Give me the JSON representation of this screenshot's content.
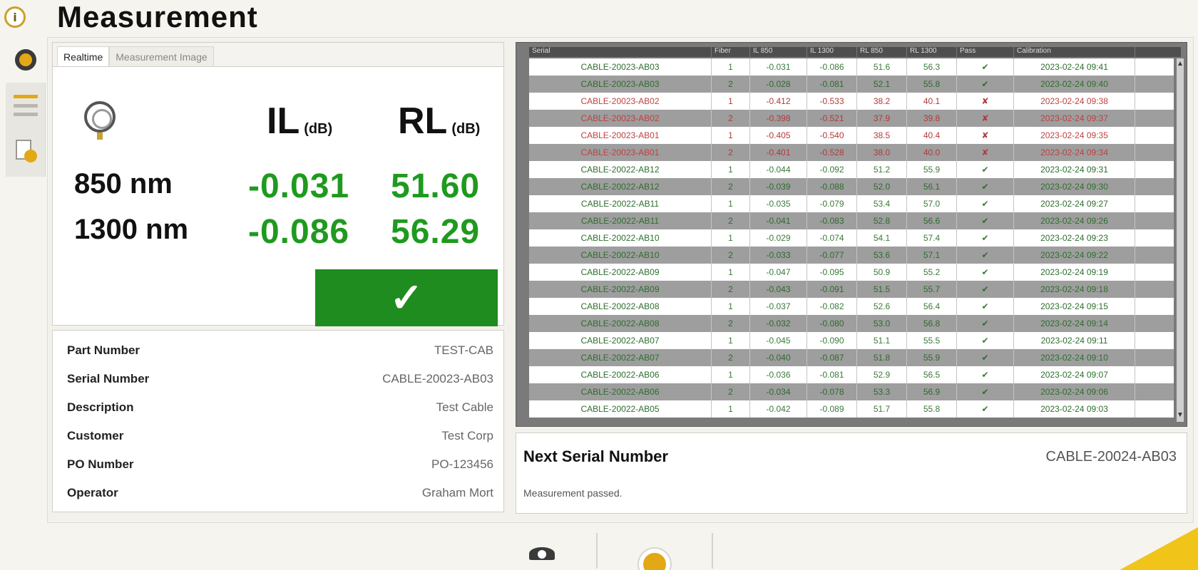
{
  "window": {
    "title": "Measurement",
    "logo_icon": "connector-logo-icon"
  },
  "rail": [
    {
      "icon": "gear-icon",
      "active": true
    },
    {
      "icon": "list-icon",
      "active": false
    },
    {
      "icon": "export-icon",
      "active": false
    }
  ],
  "measurement": {
    "tabs": [
      "Realtime",
      "Measurement Image"
    ],
    "active_tab": "Realtime",
    "connector_icon": "connector-icon",
    "il_header": "IL",
    "il_unit": "(dB)",
    "rl_header": "RL",
    "rl_unit": "(dB)",
    "rows": [
      {
        "wavelength": "850 nm",
        "il": "-0.031",
        "rl": "51.60"
      },
      {
        "wavelength": "1300 nm",
        "il": "-0.086",
        "rl": "56.29"
      }
    ],
    "result_symbol": "✓",
    "result_color": "#1f8c1f"
  },
  "info": [
    {
      "label": "Part Number",
      "value": "TEST-CAB"
    },
    {
      "label": "Serial Number",
      "value": "CABLE-20023-AB03"
    },
    {
      "label": "Description",
      "value": "Test Cable"
    },
    {
      "label": "Customer",
      "value": "Test Corp"
    },
    {
      "label": "PO Number",
      "value": "PO-123456"
    },
    {
      "label": "Operator",
      "value": "Graham Mort"
    }
  ],
  "table": {
    "columns": [
      "Serial",
      "Fiber",
      "IL 850",
      "IL 1300",
      "RL 850",
      "RL 1300",
      "Pass",
      "Calibration"
    ],
    "rows": [
      {
        "serial": "CABLE-20023-AB03",
        "fiber": "1",
        "il1": "-0.031",
        "il2": "-0.086",
        "rl1": "51.6",
        "rl2": "56.3",
        "pass": "✔",
        "cal": "2023-02-24 09:41",
        "status": "pass"
      },
      {
        "serial": "CABLE-20023-AB03",
        "fiber": "2",
        "il1": "-0.028",
        "il2": "-0.081",
        "rl1": "52.1",
        "rl2": "55.8",
        "pass": "✔",
        "cal": "2023-02-24 09:40",
        "status": "pass"
      },
      {
        "serial": "CABLE-20023-AB02",
        "fiber": "1",
        "il1": "-0.412",
        "il2": "-0.533",
        "rl1": "38.2",
        "rl2": "40.1",
        "pass": "✘",
        "cal": "2023-02-24 09:38",
        "status": "fail"
      },
      {
        "serial": "CABLE-20023-AB02",
        "fiber": "2",
        "il1": "-0.398",
        "il2": "-0.521",
        "rl1": "37.9",
        "rl2": "39.8",
        "pass": "✘",
        "cal": "2023-02-24 09:37",
        "status": "fail"
      },
      {
        "serial": "CABLE-20023-AB01",
        "fiber": "1",
        "il1": "-0.405",
        "il2": "-0.540",
        "rl1": "38.5",
        "rl2": "40.4",
        "pass": "✘",
        "cal": "2023-02-24 09:35",
        "status": "fail"
      },
      {
        "serial": "CABLE-20023-AB01",
        "fiber": "2",
        "il1": "-0.401",
        "il2": "-0.528",
        "rl1": "38.0",
        "rl2": "40.0",
        "pass": "✘",
        "cal": "2023-02-24 09:34",
        "status": "fail"
      },
      {
        "serial": "CABLE-20022-AB12",
        "fiber": "1",
        "il1": "-0.044",
        "il2": "-0.092",
        "rl1": "51.2",
        "rl2": "55.9",
        "pass": "✔",
        "cal": "2023-02-24 09:31",
        "status": "pass"
      },
      {
        "serial": "CABLE-20022-AB12",
        "fiber": "2",
        "il1": "-0.039",
        "il2": "-0.088",
        "rl1": "52.0",
        "rl2": "56.1",
        "pass": "✔",
        "cal": "2023-02-24 09:30",
        "status": "pass"
      },
      {
        "serial": "CABLE-20022-AB11",
        "fiber": "1",
        "il1": "-0.035",
        "il2": "-0.079",
        "rl1": "53.4",
        "rl2": "57.0",
        "pass": "✔",
        "cal": "2023-02-24 09:27",
        "status": "pass"
      },
      {
        "serial": "CABLE-20022-AB11",
        "fiber": "2",
        "il1": "-0.041",
        "il2": "-0.083",
        "rl1": "52.8",
        "rl2": "56.6",
        "pass": "✔",
        "cal": "2023-02-24 09:26",
        "status": "pass"
      },
      {
        "serial": "CABLE-20022-AB10",
        "fiber": "1",
        "il1": "-0.029",
        "il2": "-0.074",
        "rl1": "54.1",
        "rl2": "57.4",
        "pass": "✔",
        "cal": "2023-02-24 09:23",
        "status": "pass"
      },
      {
        "serial": "CABLE-20022-AB10",
        "fiber": "2",
        "il1": "-0.033",
        "il2": "-0.077",
        "rl1": "53.6",
        "rl2": "57.1",
        "pass": "✔",
        "cal": "2023-02-24 09:22",
        "status": "pass"
      },
      {
        "serial": "CABLE-20022-AB09",
        "fiber": "1",
        "il1": "-0.047",
        "il2": "-0.095",
        "rl1": "50.9",
        "rl2": "55.2",
        "pass": "✔",
        "cal": "2023-02-24 09:19",
        "status": "pass"
      },
      {
        "serial": "CABLE-20022-AB09",
        "fiber": "2",
        "il1": "-0.043",
        "il2": "-0.091",
        "rl1": "51.5",
        "rl2": "55.7",
        "pass": "✔",
        "cal": "2023-02-24 09:18",
        "status": "pass"
      },
      {
        "serial": "CABLE-20022-AB08",
        "fiber": "1",
        "il1": "-0.037",
        "il2": "-0.082",
        "rl1": "52.6",
        "rl2": "56.4",
        "pass": "✔",
        "cal": "2023-02-24 09:15",
        "status": "pass"
      },
      {
        "serial": "CABLE-20022-AB08",
        "fiber": "2",
        "il1": "-0.032",
        "il2": "-0.080",
        "rl1": "53.0",
        "rl2": "56.8",
        "pass": "✔",
        "cal": "2023-02-24 09:14",
        "status": "pass"
      },
      {
        "serial": "CABLE-20022-AB07",
        "fiber": "1",
        "il1": "-0.045",
        "il2": "-0.090",
        "rl1": "51.1",
        "rl2": "55.5",
        "pass": "✔",
        "cal": "2023-02-24 09:11",
        "status": "pass"
      },
      {
        "serial": "CABLE-20022-AB07",
        "fiber": "2",
        "il1": "-0.040",
        "il2": "-0.087",
        "rl1": "51.8",
        "rl2": "55.9",
        "pass": "✔",
        "cal": "2023-02-24 09:10",
        "status": "pass"
      },
      {
        "serial": "CABLE-20022-AB06",
        "fiber": "1",
        "il1": "-0.036",
        "il2": "-0.081",
        "rl1": "52.9",
        "rl2": "56.5",
        "pass": "✔",
        "cal": "2023-02-24 09:07",
        "status": "pass"
      },
      {
        "serial": "CABLE-20022-AB06",
        "fiber": "2",
        "il1": "-0.034",
        "il2": "-0.078",
        "rl1": "53.3",
        "rl2": "56.9",
        "pass": "✔",
        "cal": "2023-02-24 09:06",
        "status": "pass"
      },
      {
        "serial": "CABLE-20022-AB05",
        "fiber": "1",
        "il1": "-0.042",
        "il2": "-0.089",
        "rl1": "51.7",
        "rl2": "55.8",
        "pass": "✔",
        "cal": "2023-02-24 09:03",
        "status": "pass"
      }
    ]
  },
  "next_serial": {
    "label": "Next Serial Number",
    "value": "CABLE-20024-AB03",
    "status_message": "Measurement passed."
  },
  "toolbar": {
    "view_icon": "eye-icon",
    "start_icon": "start-measurement-icon"
  },
  "colors": {
    "accent": "#e2a815",
    "pass": "#1f8c1f",
    "fail": "#b23a3a"
  }
}
